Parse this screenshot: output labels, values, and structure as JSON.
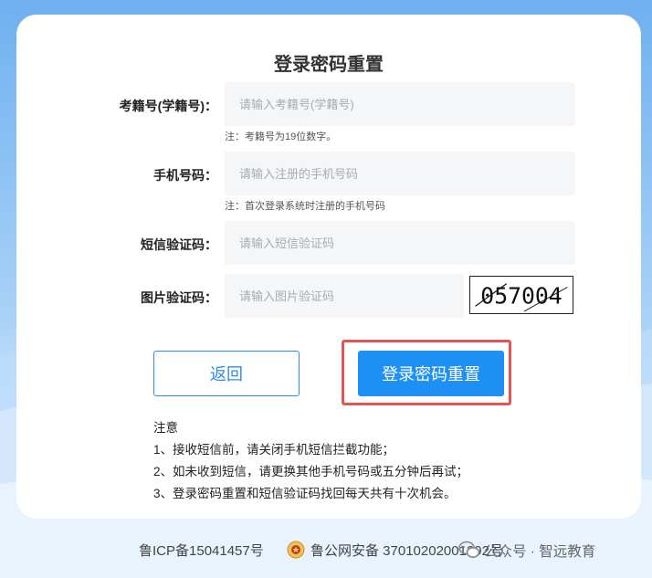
{
  "page": {
    "title": "登录密码重置"
  },
  "form": {
    "exam_no": {
      "label": "考籍号(学籍号)：",
      "placeholder": "请输入考籍号(学籍号)",
      "hint": "注：考籍号为19位数字。"
    },
    "phone": {
      "label": "手机号码：",
      "placeholder": "请输入注册的手机号码",
      "hint": "注：首次登录系统时注册的手机号码"
    },
    "sms_code": {
      "label": "短信验证码：",
      "placeholder": "请输入短信验证码"
    },
    "image_code": {
      "label": "图片验证码：",
      "placeholder": "请输入图片验证码",
      "captcha_text": "057004"
    }
  },
  "buttons": {
    "back": "返回",
    "reset": "登录密码重置"
  },
  "notes": {
    "heading": "注意",
    "items": [
      "1、接收短信前，请关闭手机短信拦截功能；",
      "2、如未收到短信，请更换其他手机号码或五分钟后再试；",
      "3、登录密码重置和短信验证码找回每天共有十次机会。"
    ]
  },
  "footer": {
    "icp": "鲁ICP备15041457号",
    "police": "鲁公网安备 37010202001292号",
    "watermark": "公众号 · 智远教育"
  },
  "colors": {
    "primary": "#1e8ff5",
    "highlight": "#e25555",
    "input_bg": "#f5f6f8"
  }
}
